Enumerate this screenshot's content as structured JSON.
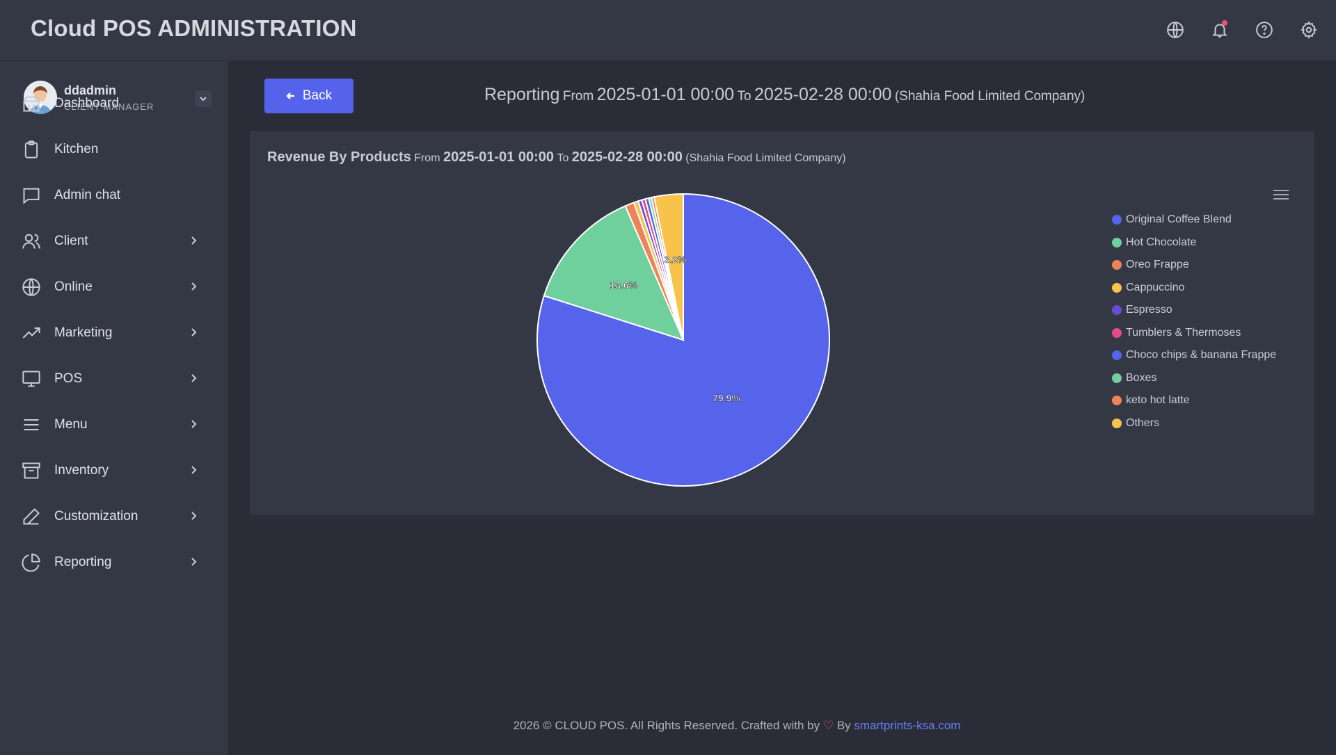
{
  "header": {
    "app_title": "Cloud POS ADMINISTRATION",
    "icons": [
      "globe-icon",
      "bell-icon",
      "help-icon",
      "gear-icon"
    ]
  },
  "user": {
    "name": "ddadmin",
    "role": "CLIENT MANAGER"
  },
  "sidebar": {
    "items": [
      {
        "label": "Dashboard",
        "icon": "dashboard-icon",
        "chevron": false
      },
      {
        "label": "Kitchen",
        "icon": "clipboard-icon",
        "chevron": false
      },
      {
        "label": "Admin chat",
        "icon": "chat-icon",
        "chevron": false
      },
      {
        "label": "Client",
        "icon": "users-icon",
        "chevron": true
      },
      {
        "label": "Online",
        "icon": "globe-icon",
        "chevron": true
      },
      {
        "label": "Marketing",
        "icon": "trend-icon",
        "chevron": true
      },
      {
        "label": "POS",
        "icon": "monitor-icon",
        "chevron": true
      },
      {
        "label": "Menu",
        "icon": "menu-icon",
        "chevron": true
      },
      {
        "label": "Inventory",
        "icon": "archive-icon",
        "chevron": true
      },
      {
        "label": "Customization",
        "icon": "pen-icon",
        "chevron": true
      },
      {
        "label": "Reporting",
        "icon": "pie-icon",
        "chevron": true
      }
    ]
  },
  "toolbar": {
    "back_label": "Back"
  },
  "page_heading": {
    "title": "Reporting",
    "from_word": "From",
    "from_date": "2025-01-01 00:00",
    "to_word": "To",
    "to_date": "2025-02-28 00:00",
    "company": "(Shahia Food Limited Company)"
  },
  "card": {
    "title": "Revenue By Products",
    "from_word": "From",
    "from_date": "2025-01-01 00:00",
    "to_word": "To",
    "to_date": "2025-02-28 00:00",
    "company": "(Shahia Food Limited Company)"
  },
  "chart_data": {
    "type": "pie",
    "title": "Revenue By Products",
    "legend_position": "right",
    "slices": [
      {
        "name": "Original Coffee Blend",
        "value": 79.9,
        "label": "79.9%",
        "color": "#5564eb"
      },
      {
        "name": "Hot Chocolate",
        "value": 13.6,
        "label": "13.6%",
        "color": "#6fcf9d"
      },
      {
        "name": "Oreo Frappe",
        "value": 1.0,
        "label": "",
        "color": "#ee8359"
      },
      {
        "name": "Cappuccino",
        "value": 0.5,
        "label": "",
        "color": "#f7c34a"
      },
      {
        "name": "Espresso",
        "value": 0.4,
        "label": "",
        "color": "#6b4bd4"
      },
      {
        "name": "Tumblers & Thermoses",
        "value": 0.4,
        "label": "",
        "color": "#e34c8c"
      },
      {
        "name": "Choco chips & banana Frappe",
        "value": 0.4,
        "label": "",
        "color": "#5564eb"
      },
      {
        "name": "Boxes",
        "value": 0.3,
        "label": "",
        "color": "#6fcf9d"
      },
      {
        "name": "keto hot latte",
        "value": 0.3,
        "label": "",
        "color": "#ee8359"
      },
      {
        "name": "Others",
        "value": 3.2,
        "label": "3.2%",
        "color": "#f7c34a"
      }
    ]
  },
  "footer": {
    "text": "2026 © CLOUD POS. All Rights Reserved. Crafted with by",
    "heart": "♡",
    "by": "By",
    "link": "smartprints-ksa.com"
  }
}
